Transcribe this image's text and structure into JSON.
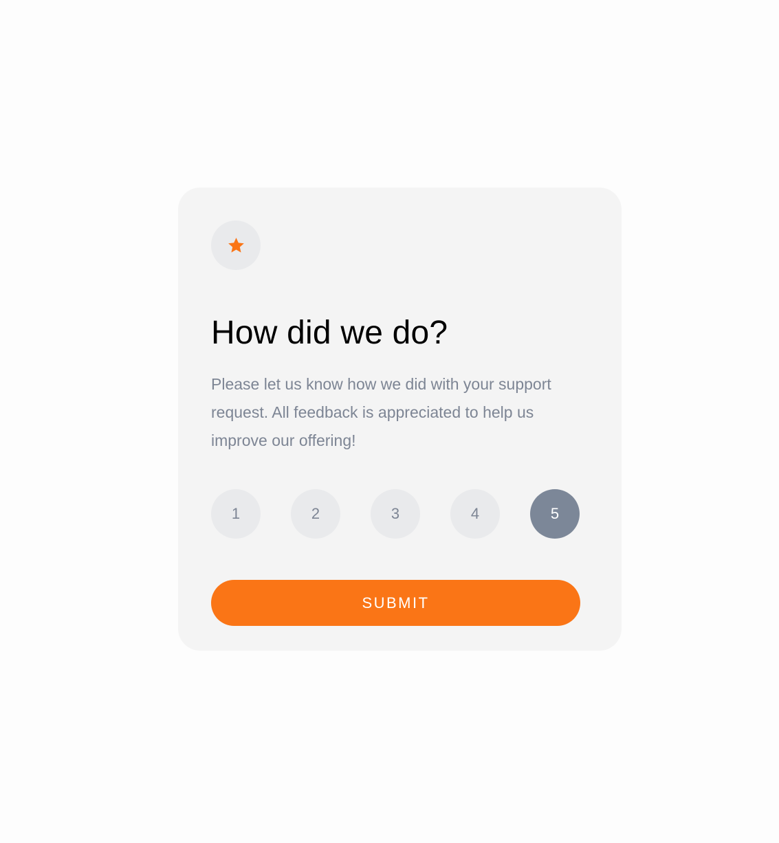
{
  "card": {
    "icon": "star-icon",
    "title": "How did we do?",
    "description": "Please let us know how we did with your support request. All feedback is appreciated to help us improve our offering!"
  },
  "ratings": {
    "options": [
      "1",
      "2",
      "3",
      "4",
      "5"
    ],
    "selected": "5"
  },
  "submit": {
    "label": "SUBMIT"
  },
  "colors": {
    "accent": "#fa7516",
    "selected_rating": "#7c8798",
    "muted_text": "#7d8594",
    "card_background": "#f4f4f4"
  }
}
